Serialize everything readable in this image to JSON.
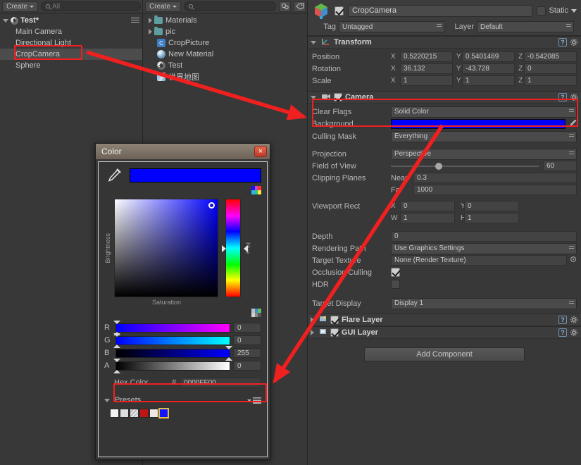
{
  "hierarchy": {
    "toolbar": {
      "create_label": "Create",
      "search_placeholder": "All"
    },
    "scene_name": "Test*",
    "items": [
      {
        "label": "Main Camera",
        "selected": false
      },
      {
        "label": "Directional Light",
        "selected": false
      },
      {
        "label": "CropCamera",
        "selected": true
      },
      {
        "label": "Sphere",
        "selected": false
      }
    ]
  },
  "project": {
    "toolbar": {
      "create_label": "Create",
      "search_placeholder": ""
    },
    "items": [
      {
        "label": "Materials",
        "icon": "folder-icon",
        "expandable": true
      },
      {
        "label": "pic",
        "icon": "folder-icon",
        "expandable": true
      },
      {
        "label": "CropPicture",
        "icon": "script-icon",
        "expandable": false
      },
      {
        "label": "New Material",
        "icon": "material-icon",
        "expandable": false
      },
      {
        "label": "Test",
        "icon": "unity-scene-icon",
        "expandable": false
      },
      {
        "label": "世界地图",
        "icon": "texture-icon",
        "expandable": false
      }
    ]
  },
  "inspector": {
    "object_name": "CropCamera",
    "object_enabled": true,
    "static_label": "Static",
    "tag_label": "Tag",
    "tag_value": "Untagged",
    "layer_label": "Layer",
    "layer_value": "Default",
    "transform": {
      "title": "Transform",
      "rows": [
        {
          "label": "Position",
          "x": "0.5220215",
          "y": "0.5401469",
          "z": "-0.542085"
        },
        {
          "label": "Rotation",
          "x": "36.132",
          "y": "-43.728",
          "z": "0"
        },
        {
          "label": "Scale",
          "x": "1",
          "y": "1",
          "z": "1"
        }
      ],
      "axis_labels": [
        "X",
        "Y",
        "Z"
      ]
    },
    "camera": {
      "title": "Camera",
      "enabled": true,
      "clear_flags_label": "Clear Flags",
      "clear_flags_value": "Solid Color",
      "background_label": "Background",
      "background_color": "#0000ff",
      "culling_mask_label": "Culling Mask",
      "culling_mask_value": "Everything",
      "projection_label": "Projection",
      "projection_value": "Perspective",
      "fov_label": "Field of View",
      "fov_value": "60",
      "clipping_label": "Clipping Planes",
      "near_label": "Near",
      "near_value": "0.3",
      "far_label": "Far",
      "far_value": "1000",
      "viewport_label": "Viewport Rect",
      "viewport_x_label": "X",
      "viewport_x": "0",
      "viewport_y_label": "Y",
      "viewport_y": "0",
      "viewport_w_label": "W",
      "viewport_w": "1",
      "viewport_h_label": "H",
      "viewport_h": "1",
      "depth_label": "Depth",
      "depth_value": "0",
      "rendering_path_label": "Rendering Path",
      "rendering_path_value": "Use Graphics Settings",
      "target_texture_label": "Target Texture",
      "target_texture_value": "None (Render Texture)",
      "occlusion_label": "Occlusion Culling",
      "occlusion_checked": true,
      "hdr_label": "HDR",
      "hdr_checked": false,
      "target_display_label": "Target Display",
      "target_display_value": "Display 1"
    },
    "components": [
      {
        "title": "Flare Layer",
        "enabled": true
      },
      {
        "title": "GUI Layer",
        "enabled": true
      }
    ],
    "add_component_label": "Add Component"
  },
  "color_dialog": {
    "title": "Color",
    "close_label": "×",
    "preview_color": "#0000ff",
    "brightness_label": "Brightness",
    "saturation_label": "Saturation",
    "hue_label": "Hue",
    "channels": [
      {
        "name": "R",
        "value": "0"
      },
      {
        "name": "G",
        "value": "0"
      },
      {
        "name": "B",
        "value": "255"
      },
      {
        "name": "A",
        "value": "0"
      }
    ],
    "hex_label": "Hex Color",
    "hex_hash": "#",
    "hex_value": "0000FF00",
    "presets_label": "Presets",
    "preset_colors": [
      "#f4f4f2",
      "#dedede",
      "#cfcfcf",
      "#c01515",
      "#efe7e3",
      "#1414ff"
    ],
    "selected_preset_index": 5
  },
  "annotations": {
    "accent_color": "#f02020"
  }
}
